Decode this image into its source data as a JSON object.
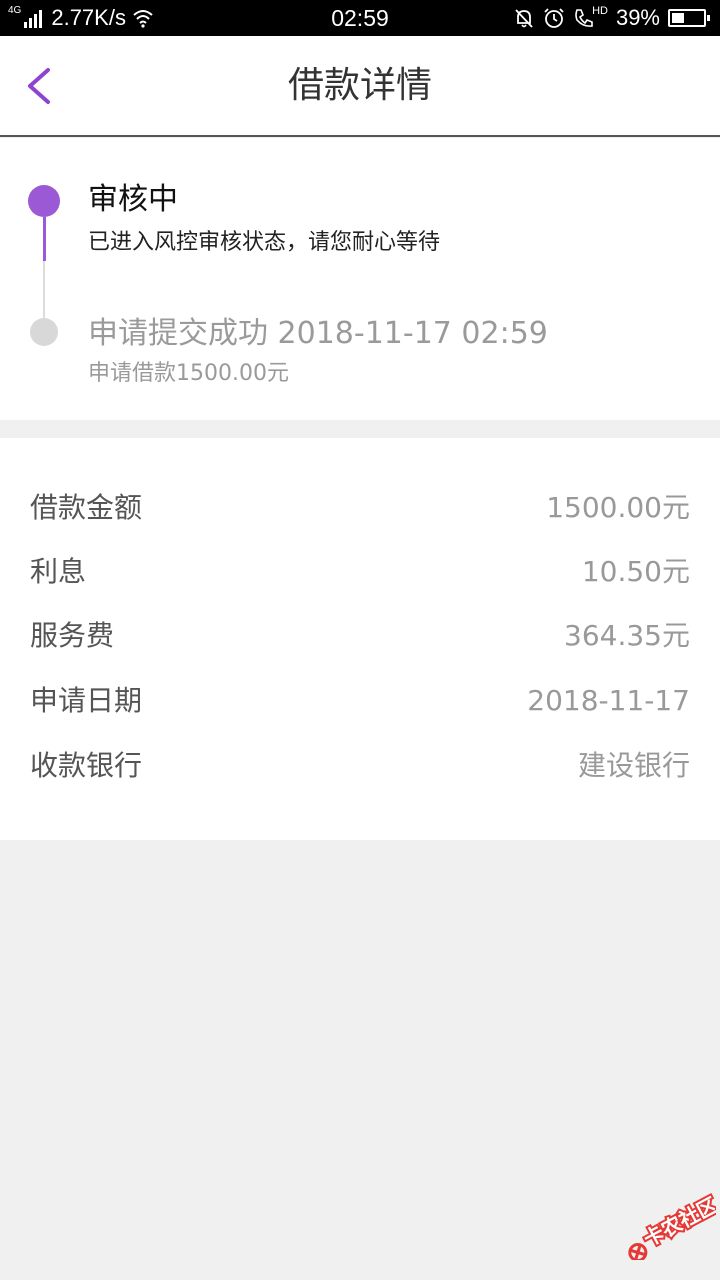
{
  "status_bar": {
    "network_type": "4G",
    "speed": "2.77K/s",
    "time": "02:59",
    "hd_label": "HD",
    "battery_percent": "39%",
    "battery_level": 0.39
  },
  "header": {
    "title": "借款详情",
    "accent_color": "#9b59d6"
  },
  "timeline": [
    {
      "title": "审核中",
      "subtitle": "已进入风控审核状态，请您耐心等待",
      "state": "active"
    },
    {
      "title": "申请提交成功 2018-11-17 02:59",
      "subtitle": "申请借款1500.00元",
      "state": "done"
    }
  ],
  "details": [
    {
      "label": "借款金额",
      "value": "1500.00元"
    },
    {
      "label": "利息",
      "value": "10.50元"
    },
    {
      "label": "服务费",
      "value": "364.35元"
    },
    {
      "label": "申请日期",
      "value": "2018-11-17"
    },
    {
      "label": "收款银行",
      "value": "建设银行"
    }
  ],
  "watermark": {
    "text": "卡农社区",
    "icons": [
      "back-chevron-icon",
      "signal-icon",
      "wifi-icon",
      "bell-off-icon",
      "alarm-icon",
      "call-hd-icon",
      "battery-icon",
      "watermark-logo-icon"
    ]
  }
}
